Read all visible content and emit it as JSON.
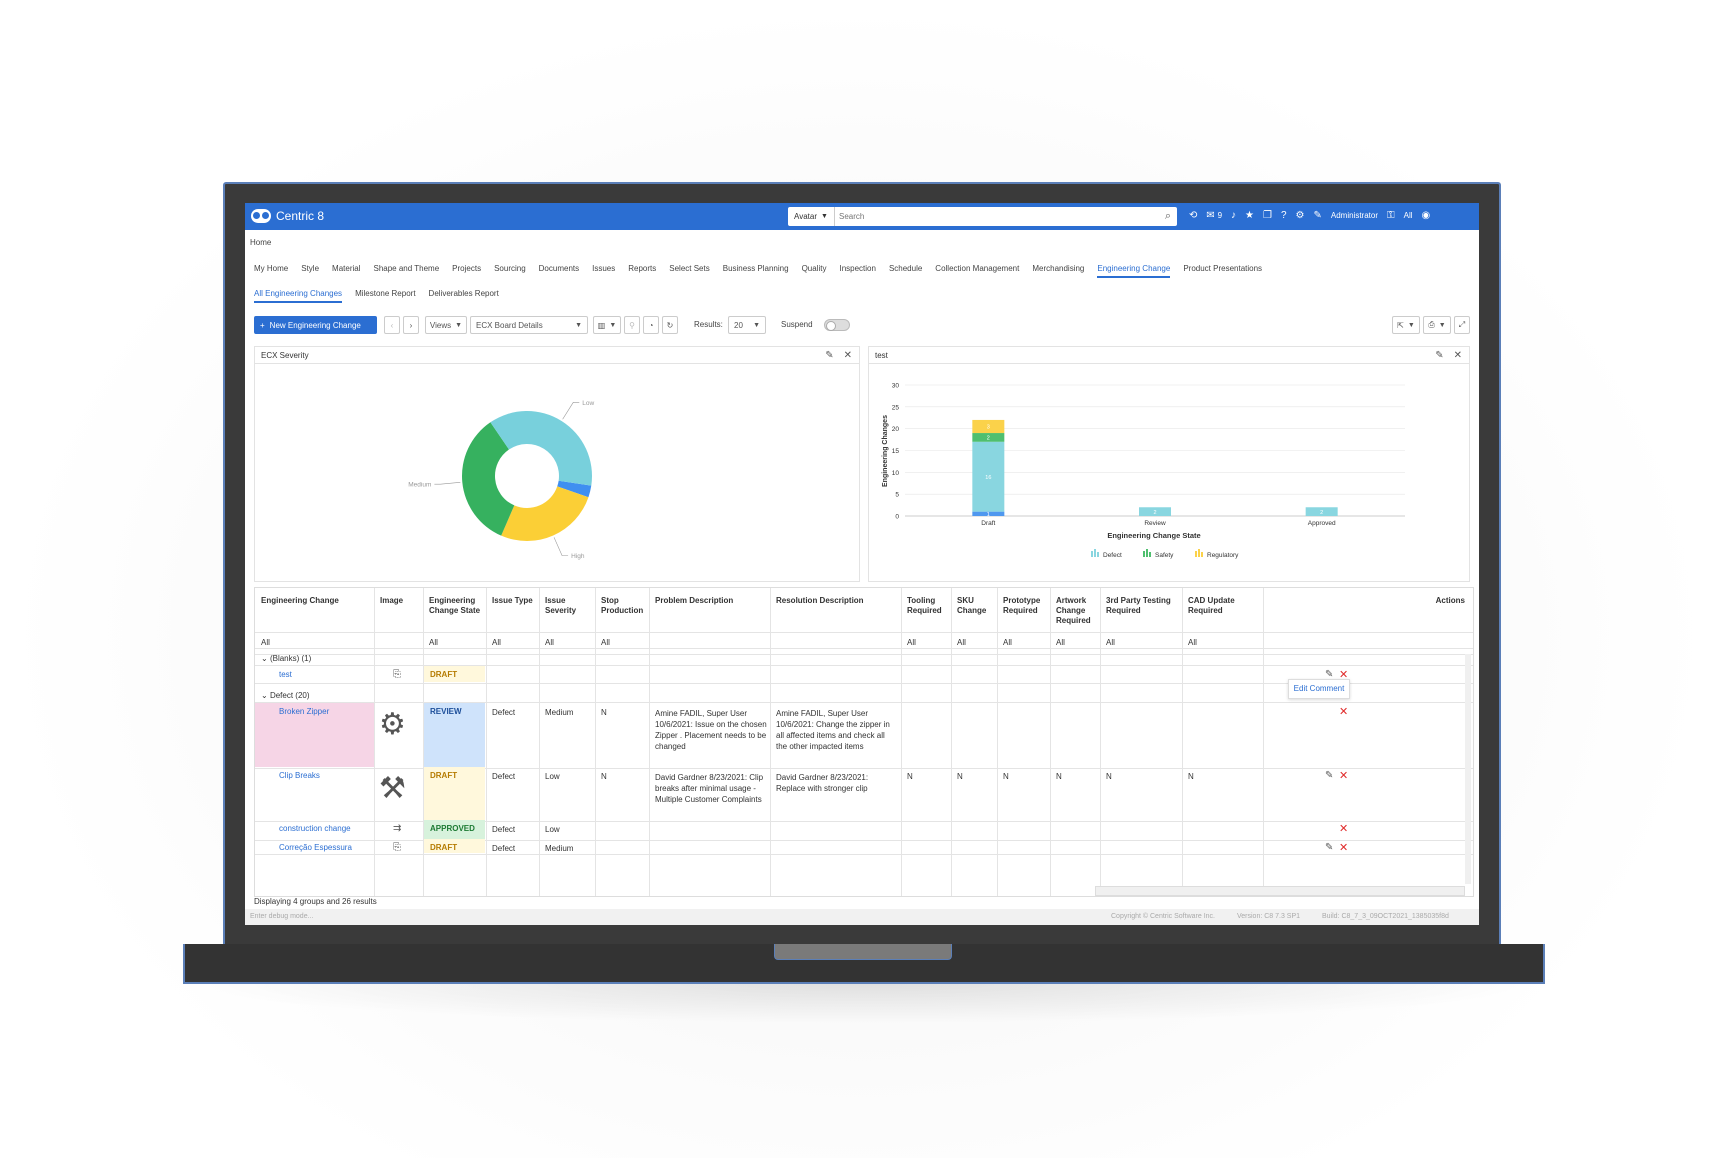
{
  "app": {
    "title": "Centric 8"
  },
  "search": {
    "scope": "Avatar",
    "placeholder": "Search"
  },
  "topbar": {
    "messages_count": "9",
    "user": "Administrator",
    "access": "All"
  },
  "breadcrumb": "Home",
  "main_nav": [
    "My Home",
    "Style",
    "Material",
    "Shape and Theme",
    "Projects",
    "Sourcing",
    "Documents",
    "Issues",
    "Reports",
    "Select Sets",
    "Business Planning",
    "Quality",
    "Inspection",
    "Schedule",
    "Collection Management",
    "Merchandising",
    "Engineering Change",
    "Product Presentations"
  ],
  "main_nav_active": "Engineering Change",
  "sub_nav": [
    "All Engineering Changes",
    "Milestone Report",
    "Deliverables Report"
  ],
  "toolbar": {
    "new_button": "New Engineering Change",
    "views": "Views",
    "view_select": "ECX Board Details",
    "results_label": "Results:",
    "results_value": "20",
    "suspend_label": "Suspend"
  },
  "panels": {
    "left_title": "ECX Severity",
    "right_title": "test"
  },
  "chart_data": [
    {
      "type": "pie",
      "title": "",
      "labels": [
        "Low",
        "Medium",
        "High"
      ],
      "values": [
        38,
        35,
        27
      ],
      "extra_slice_color": "#3f8ff0",
      "colors": [
        "#78d0dc",
        "#36b15f",
        "#fbcf36"
      ]
    },
    {
      "type": "bar",
      "stacked": true,
      "xlabel": "Engineering Change State",
      "ylabel": "Engineering Changes",
      "categories": [
        "Draft",
        "Review",
        "Approved"
      ],
      "ylim": [
        0,
        30
      ],
      "yticks": [
        0,
        5,
        10,
        15,
        20,
        25,
        30
      ],
      "series": [
        {
          "name": "Defect",
          "values": [
            16,
            2,
            2
          ],
          "color": "#89d6e0"
        },
        {
          "name": "Safety",
          "values": [
            2,
            0,
            0
          ],
          "color": "#4fbf6f"
        },
        {
          "name": "Regulatory",
          "values": [
            3,
            0,
            0
          ],
          "color": "#fbd24a"
        },
        {
          "name": "",
          "values": [
            1,
            0,
            0
          ],
          "color": "#4f98ef"
        }
      ],
      "segment_labels": [
        "1",
        "16",
        "2",
        "3",
        "2",
        "2"
      ]
    }
  ],
  "grid": {
    "columns": [
      "Engineering Change",
      "Image",
      "Engineering Change State",
      "Issue Type",
      "Issue Severity",
      "Stop Production",
      "Problem Description",
      "Resolution Description",
      "Tooling Required",
      "SKU Change",
      "Prototype Required",
      "Artwork Change Required",
      "3rd Party Testing Required",
      "CAD Update Required",
      "Actions"
    ],
    "filters": [
      "All",
      "",
      "All",
      "All",
      "All",
      "All",
      "",
      "",
      "All",
      "All",
      "All",
      "All",
      "All",
      "All"
    ],
    "groups": [
      {
        "label": "(Blanks) (1)"
      },
      {
        "label": "Defect (20)"
      }
    ],
    "rows": [
      {
        "name": "test",
        "state": "DRAFT",
        "issue_type": "",
        "severity": "",
        "stop": "",
        "problem": "",
        "resolution": "",
        "flags": [
          "",
          "",
          "",
          "",
          "",
          ""
        ]
      },
      {
        "name": "Broken Zipper",
        "state": "REVIEW",
        "issue_type": "Defect",
        "severity": "Medium",
        "stop": "N",
        "problem": "Amine FADIL, Super User 10/6/2021: Issue on the chosen Zipper . Placement needs to be changed",
        "resolution": "Amine FADIL, Super User 10/6/2021: Change the zipper in all affected items and check all the other impacted items",
        "flags": [
          "",
          "",
          "",
          "",
          "",
          ""
        ]
      },
      {
        "name": "Clip Breaks",
        "state": "DRAFT",
        "issue_type": "Defect",
        "severity": "Low",
        "stop": "N",
        "problem": "David Gardner 8/23/2021: Clip breaks after minimal usage - Multiple Customer Complaints",
        "resolution": "David Gardner 8/23/2021: Replace with stronger clip",
        "flags": [
          "N",
          "N",
          "N",
          "N",
          "N",
          "N"
        ]
      },
      {
        "name": "construction change",
        "state": "APPROVED",
        "issue_type": "Defect",
        "severity": "Low",
        "stop": "",
        "problem": "",
        "resolution": "",
        "flags": [
          "",
          "",
          "",
          "",
          "",
          ""
        ]
      },
      {
        "name": "Correção Espessura",
        "state": "DRAFT",
        "issue_type": "Defect",
        "severity": "Medium",
        "stop": "",
        "problem": "",
        "resolution": "",
        "flags": [
          "",
          "",
          "",
          "",
          "",
          ""
        ]
      }
    ],
    "tooltip": "Edit Comment",
    "footer": "Displaying 4 groups and 26 results"
  },
  "app_footer": {
    "debug": "Enter debug mode...",
    "copyright": "Copyright © Centric Software Inc.",
    "version": "Version: C8 7.3 SP1",
    "build": "Build: C8_7_3_09OCT2021_1385035f8d"
  },
  "colors": {
    "brand": "#2b6ed2",
    "draft_bg": "#fff8dc",
    "review_bg": "#cfe3fb",
    "approved_bg": "#d7f2dc",
    "highlight_row": "#f6d5e6"
  }
}
